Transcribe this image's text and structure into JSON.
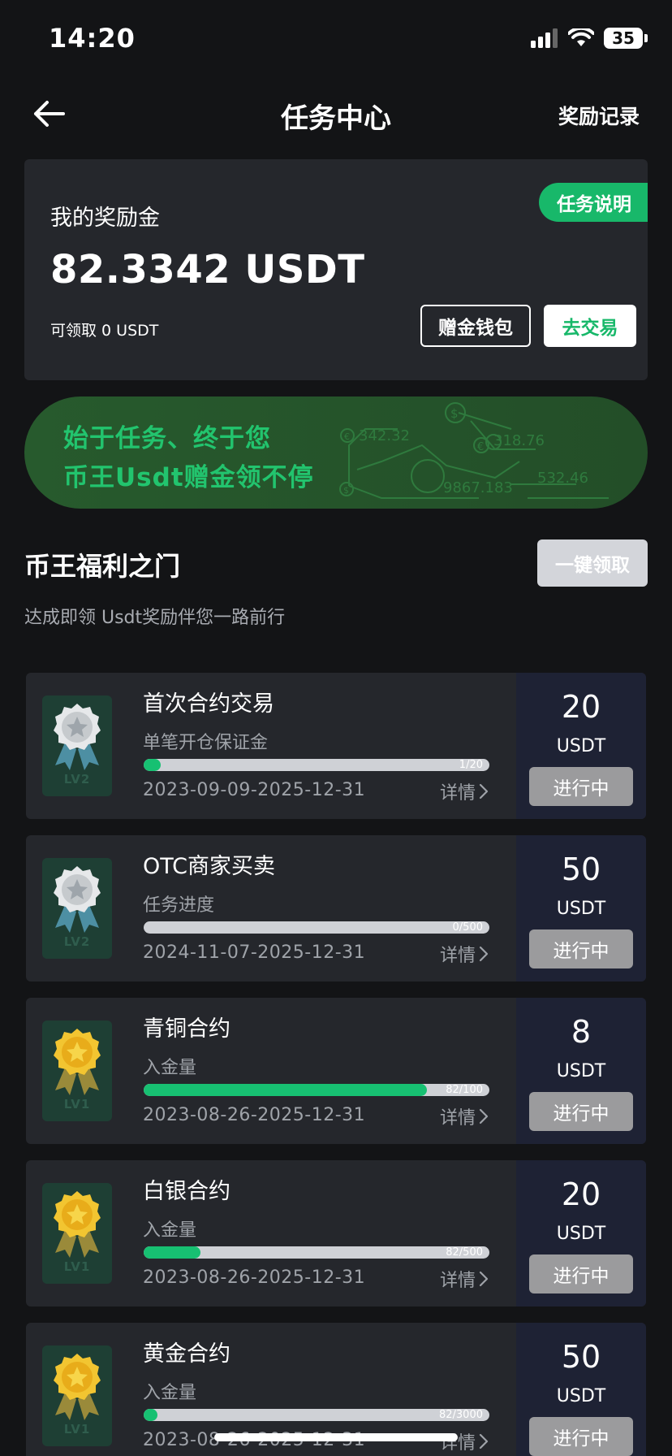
{
  "status_bar": {
    "time": "14:20",
    "battery": "35"
  },
  "nav": {
    "title": "任务中心",
    "right": "奖励记录"
  },
  "reward_card": {
    "task_desc": "任务说明",
    "label": "我的奖励金",
    "amount": "82.3342 USDT",
    "claimable": "可领取 0 USDT",
    "bonus_wallet": "赠金钱包",
    "trade": "去交易"
  },
  "banner": {
    "line1": "始于任务、终于您",
    "line2": "币王Usdt赠金领不停",
    "numbers": [
      "342.32",
      "318.76",
      "9867.183",
      "532.46"
    ]
  },
  "section": {
    "title": "币王福利之门",
    "subtitle": "达成即领 Usdt奖励伴您一路前行",
    "claim_all": "一键领取"
  },
  "tasks": [
    {
      "name": "首次合约交易",
      "sub": "单笔开仓保证金",
      "progress": "1/20",
      "ratio": 0.05,
      "date": "2023-09-09-2025-12-31",
      "detail": "详情",
      "reward": "20",
      "unit": "USDT",
      "status": "进行中",
      "medal": "silver",
      "level": "LV2"
    },
    {
      "name": "OTC商家买卖",
      "sub": "任务进度",
      "progress": "0/500",
      "ratio": 0,
      "date": "2024-11-07-2025-12-31",
      "detail": "详情",
      "reward": "50",
      "unit": "USDT",
      "status": "进行中",
      "medal": "silver",
      "level": "LV2"
    },
    {
      "name": "青铜合约",
      "sub": "入金量",
      "progress": "82/100",
      "ratio": 0.82,
      "date": "2023-08-26-2025-12-31",
      "detail": "详情",
      "reward": "8",
      "unit": "USDT",
      "status": "进行中",
      "medal": "gold",
      "level": "LV1"
    },
    {
      "name": "白银合约",
      "sub": "入金量",
      "progress": "82/500",
      "ratio": 0.164,
      "date": "2023-08-26-2025-12-31",
      "detail": "详情",
      "reward": "20",
      "unit": "USDT",
      "status": "进行中",
      "medal": "gold",
      "level": "LV1"
    },
    {
      "name": "黄金合约",
      "sub": "入金量",
      "progress": "82/3000",
      "ratio": 0.027,
      "date": "2023-08-26-2025-12-31",
      "detail": "详情",
      "reward": "50",
      "unit": "USDT",
      "status": "进行中",
      "medal": "gold",
      "level": "LV1"
    }
  ],
  "colors": {
    "accent": "#18b86a",
    "card": "#25272c",
    "reward_panel": "#1e2234"
  }
}
